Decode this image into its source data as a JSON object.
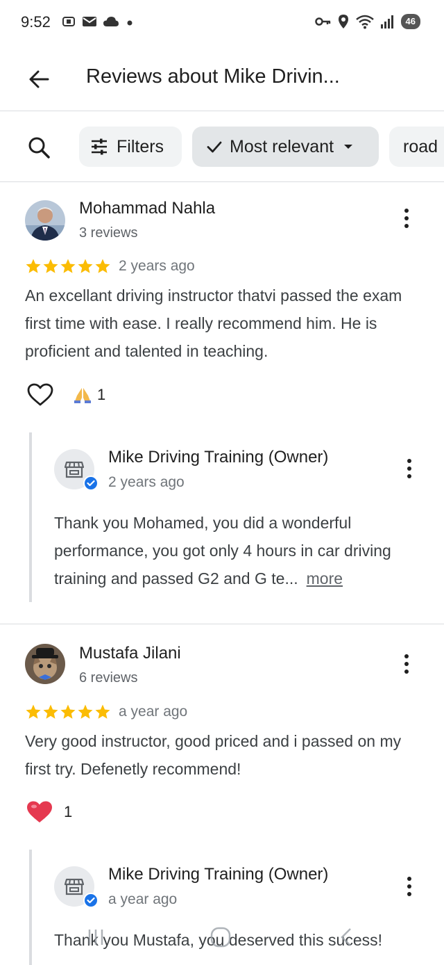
{
  "status_bar": {
    "time": "9:52",
    "battery": "46",
    "icons_left": [
      "screenshot-icon",
      "mail-icon",
      "cloud-icon",
      "dot-icon"
    ],
    "icons_right": [
      "key-icon",
      "location-icon",
      "wifi-icon",
      "signal-icon",
      "battery-icon"
    ]
  },
  "app_bar": {
    "title": "Reviews about Mike Drivin..."
  },
  "filters": {
    "filters_label": "Filters",
    "sort_label": "Most relevant",
    "topic_chip": "road"
  },
  "colors": {
    "star": "#fbbc04",
    "verified": "#1a73e8",
    "divider": "#dadce0",
    "chip_bg": "#f1f3f4",
    "heart_red": "#e53950"
  },
  "reviews": [
    {
      "name": "Mohammad Nahla",
      "meta": "3 reviews",
      "rating": 5,
      "date": "2 years ago",
      "text": "An excellant driving instructor thatvi passed the exam first time with ease. I really recommend him. He is proficient and talented in teaching.",
      "reaction_icon": "folded-hands-icon",
      "reaction_count": "1",
      "owner_reply": {
        "name": "Mike Driving Training (Owner)",
        "date": "2 years ago",
        "text": "Thank you Mohamed, you did a wonderful performance, you got only 4 hours in car driving training and passed G2 and G te...",
        "more_label": "more"
      }
    },
    {
      "name": "Mustafa Jilani",
      "meta": "6 reviews",
      "rating": 5,
      "date": "a year ago",
      "text": "Very good instructor, good priced and i passed on my first try. Defenetly recommend!",
      "reaction_icon": "heart-icon",
      "reaction_count": "1",
      "owner_reply": {
        "name": "Mike Driving Training (Owner)",
        "date": "a year ago",
        "text": "Thank you Mustafa, you deserved this sucess!"
      }
    }
  ]
}
